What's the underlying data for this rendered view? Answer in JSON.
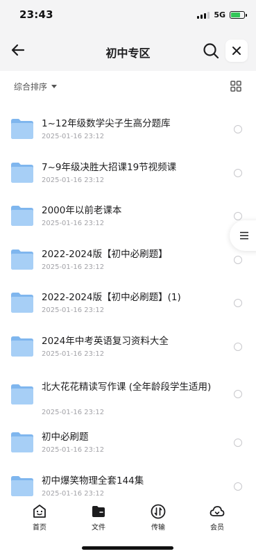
{
  "status": {
    "time": "23:43",
    "network": "5G"
  },
  "header": {
    "title": "初中专区"
  },
  "sort": {
    "label": "综合排序"
  },
  "files": [
    {
      "name": "1~12年级数学尖子生高分题库",
      "date": "2025-01-16 23:12"
    },
    {
      "name": "7~9年级决胜大招课19节视频课",
      "date": "2025-01-16 23:12"
    },
    {
      "name": "2000年以前老课本",
      "date": "2025-01-16 23:12"
    },
    {
      "name": "2022-2024版【初中必刷题】",
      "date": "2025-01-16 23:12"
    },
    {
      "name": "2022-2024版【初中必刷题】(1)",
      "date": "2025-01-16 23:12"
    },
    {
      "name": "2024年中考英语复习资料大全",
      "date": "2025-01-16 23:12"
    },
    {
      "name": "北大花花精读写作课 (全年龄段学生适用)",
      "date": "2025-01-16 23:12"
    },
    {
      "name": "初中必刷题",
      "date": "2025-01-16 23:12"
    },
    {
      "name": "初中爆笑物理全套144集",
      "date": "2025-01-16 23:12"
    }
  ],
  "tabs": [
    {
      "label": "首页",
      "icon": "home-face-icon"
    },
    {
      "label": "文件",
      "icon": "folder-tab-icon"
    },
    {
      "label": "传输",
      "icon": "transfer-icon"
    },
    {
      "label": "会员",
      "icon": "cloud-member-icon"
    }
  ],
  "colors": {
    "folder": "#7fb6ee",
    "folder_light": "#a7cff6",
    "background": "#f4f4f5"
  }
}
